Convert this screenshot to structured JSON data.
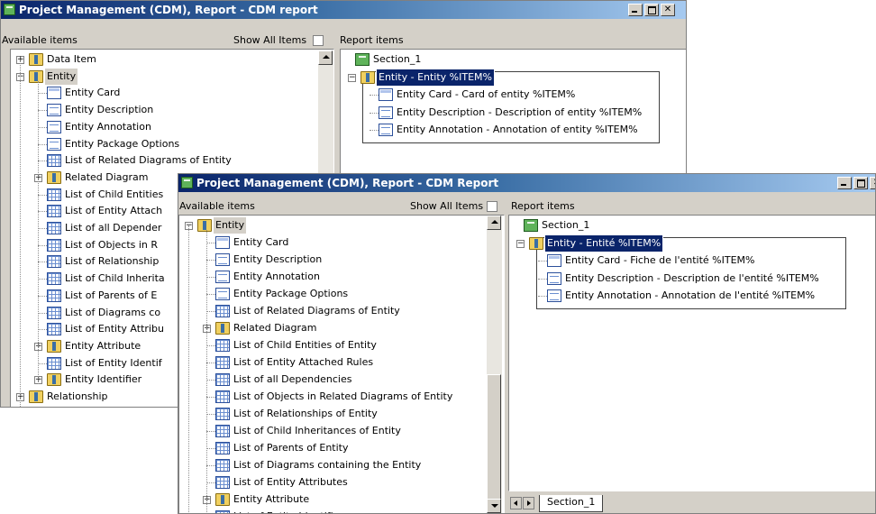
{
  "window1": {
    "title": "Project Management (CDM), Report - CDM report",
    "available_items_label": "Available items",
    "show_all_items_label": "Show All Items",
    "report_items_label": "Report items",
    "left_tree": [
      {
        "label": "Data Item",
        "icon": "folder-icon",
        "expander": "+"
      },
      {
        "label": "Entity",
        "icon": "folder-icon",
        "expander": "-",
        "highlight": true
      },
      {
        "label": "Entity Card",
        "icon": "card-icon"
      },
      {
        "label": "Entity Description",
        "icon": "document-icon"
      },
      {
        "label": "Entity Annotation",
        "icon": "document-icon"
      },
      {
        "label": "Entity Package Options",
        "icon": "document-icon"
      },
      {
        "label": "List of Related Diagrams of Entity",
        "icon": "grid-icon"
      },
      {
        "label": "Related Diagram",
        "icon": "folder-icon",
        "expander": "+"
      },
      {
        "label": "List of Child Entities",
        "icon": "grid-icon"
      },
      {
        "label": "List of Entity Attach",
        "icon": "grid-icon"
      },
      {
        "label": "List of all Depender",
        "icon": "grid-icon"
      },
      {
        "label": "List of Objects in R",
        "icon": "grid-icon"
      },
      {
        "label": "List of Relationship",
        "icon": "grid-icon"
      },
      {
        "label": "List of Child Inherita",
        "icon": "grid-icon"
      },
      {
        "label": "List of Parents of E",
        "icon": "grid-icon"
      },
      {
        "label": "List of Diagrams co",
        "icon": "grid-icon"
      },
      {
        "label": "List of Entity Attribu",
        "icon": "grid-icon"
      },
      {
        "label": "Entity Attribute",
        "icon": "folder-icon",
        "expander": "+"
      },
      {
        "label": "List of Entity Identif",
        "icon": "grid-icon"
      },
      {
        "label": "Entity Identifier",
        "icon": "folder-icon",
        "expander": "+"
      },
      {
        "label": "Relationship",
        "icon": "folder-icon",
        "expander": "+"
      }
    ],
    "right_tree": {
      "section": "Section_1",
      "root": "Entity - Entity %ITEM%",
      "children": [
        "Entity Card - Card of entity %ITEM%",
        "Entity Description - Description of entity %ITEM%",
        "Entity Annotation - Annotation of entity %ITEM%"
      ]
    }
  },
  "window2": {
    "title": "Project Management (CDM), Report - CDM Report",
    "available_items_label": "Available items",
    "show_all_items_label": "Show All Items",
    "report_items_label": "Report items",
    "left_tree": [
      {
        "label": "Entity",
        "icon": "folder-icon",
        "expander": "-",
        "highlight": true
      },
      {
        "label": "Entity Card",
        "icon": "card-icon"
      },
      {
        "label": "Entity Description",
        "icon": "document-icon"
      },
      {
        "label": "Entity Annotation",
        "icon": "document-icon"
      },
      {
        "label": "Entity Package Options",
        "icon": "document-icon"
      },
      {
        "label": "List of Related Diagrams of Entity",
        "icon": "grid-icon"
      },
      {
        "label": "Related Diagram",
        "icon": "folder-icon",
        "expander": "+"
      },
      {
        "label": "List of Child Entities of Entity",
        "icon": "grid-icon"
      },
      {
        "label": "List of Entity Attached Rules",
        "icon": "grid-icon"
      },
      {
        "label": "List of all Dependencies",
        "icon": "grid-icon"
      },
      {
        "label": "List of Objects in Related Diagrams of Entity",
        "icon": "grid-icon"
      },
      {
        "label": "List of Relationships of Entity",
        "icon": "grid-icon"
      },
      {
        "label": "List of Child Inheritances of Entity",
        "icon": "grid-icon"
      },
      {
        "label": "List of Parents of Entity",
        "icon": "grid-icon"
      },
      {
        "label": "List of Diagrams containing the Entity",
        "icon": "grid-icon"
      },
      {
        "label": "List of Entity Attributes",
        "icon": "grid-icon"
      },
      {
        "label": "Entity Attribute",
        "icon": "folder-icon",
        "expander": "+"
      },
      {
        "label": "List of Entity Identifiers",
        "icon": "grid-icon"
      }
    ],
    "right_tree": {
      "section": "Section_1",
      "root": "Entity - Entité %ITEM%",
      "children": [
        "Entity Card - Fiche de l'entité %ITEM%",
        "Entity Description - Description de l'entité %ITEM%",
        "Entity Annotation - Annotation de l'entité %ITEM%"
      ]
    },
    "tab_label": "Section_1"
  }
}
